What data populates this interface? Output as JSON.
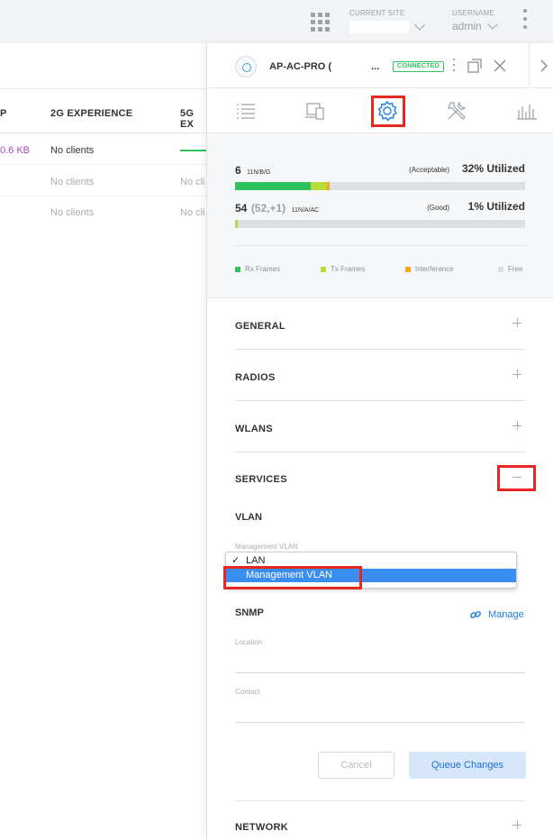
{
  "topbar": {
    "site_label": "CURRENT SITE",
    "site_value": "",
    "username_label": "USERNAME",
    "username_value": "admin"
  },
  "table": {
    "headers": [
      "P",
      "2G EXPERIENCE",
      "5G EX"
    ],
    "rows": [
      {
        "col1": "0.6 KB",
        "col2": "No clients",
        "col3": ""
      },
      {
        "col1": "",
        "col2": "No clients",
        "col3": "No cli"
      },
      {
        "col1": "",
        "col2": "No clients",
        "col3": "No cli"
      }
    ]
  },
  "panel": {
    "device_name": "AP-AC-PRO (",
    "device_name_trail": "...",
    "status": "CONNECTED",
    "tabs": [
      "details-tab",
      "clients-tab",
      "config-tab",
      "tools-tab",
      "stats-tab"
    ],
    "active_tab": "config-tab",
    "rf": {
      "channels": [
        {
          "channel": "6",
          "channel_sub": "",
          "band": "11N/B/G",
          "quality": "(Acceptable)",
          "utilization": "32% Utilized",
          "segments": {
            "rx": 0.26,
            "tx": 0.055,
            "interference": 0.01
          }
        },
        {
          "channel": "54",
          "channel_sub": "(52,+1)",
          "band": "11N/A/AC",
          "quality": "(Good)",
          "utilization": "1% Utilized",
          "segments": {
            "rx": 0.0,
            "tx": 0.01,
            "interference": 0.0
          }
        }
      ],
      "legend": [
        "Rx Frames",
        "Tx Frames",
        "Interference",
        "Free"
      ],
      "colors": {
        "rx": "#2ec25c",
        "tx": "#b6dc3a",
        "interference": "#f5a623",
        "free": "#dcdfe3"
      }
    },
    "sections": {
      "general": "GENERAL",
      "radios": "RADIOS",
      "wlans": "WLANS",
      "services": "SERVICES",
      "network": "NETWORK"
    },
    "vlan": {
      "title": "VLAN",
      "field_label": "Management VLAN",
      "options": [
        "LAN",
        "Management VLAN"
      ],
      "checked": "LAN",
      "highlighted": "Management VLAN"
    },
    "snmp": {
      "title": "SNMP",
      "manage_label": "Manage",
      "location_label": "Location",
      "contact_label": "Contact"
    },
    "buttons": {
      "cancel": "Cancel",
      "queue": "Queue Changes"
    },
    "accent": "#1d7de5",
    "highlight_color": "#e8271e"
  }
}
